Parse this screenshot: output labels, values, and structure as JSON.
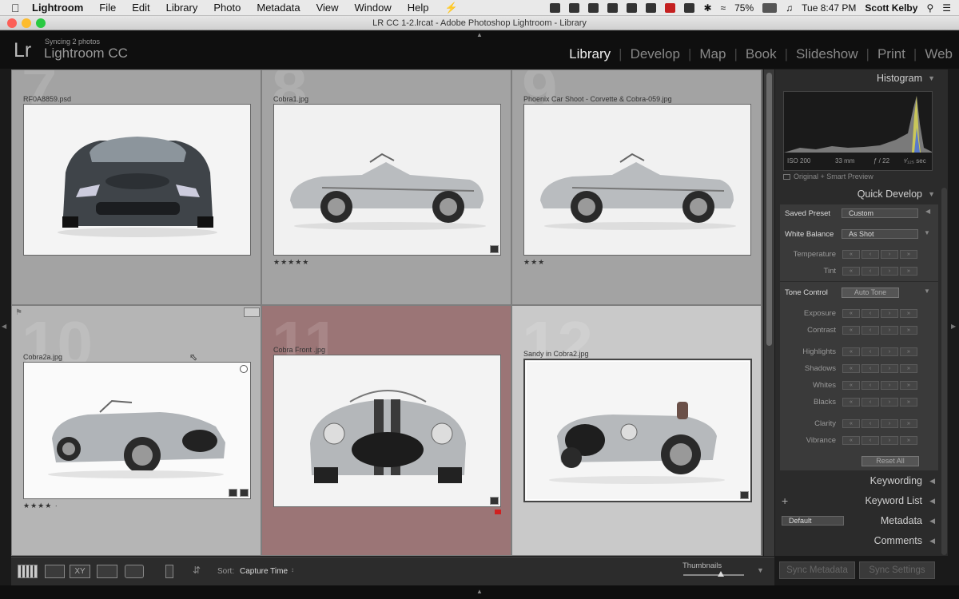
{
  "menubar": {
    "app": "Lightroom",
    "items": [
      "File",
      "Edit",
      "Library",
      "Photo",
      "Metadata",
      "View",
      "Window",
      "Help"
    ],
    "battery": "75%",
    "clock": "Tue 8:47 PM",
    "user": "Scott Kelby"
  },
  "window": {
    "title": "LR CC 1-2.lrcat - Adobe Photoshop Lightroom - Library"
  },
  "identity": {
    "logo": "Lr",
    "sync_status": "Syncing 2 photos",
    "app_name": "Lightroom CC"
  },
  "modules": [
    "Library",
    "Develop",
    "Map",
    "Book",
    "Slideshow",
    "Print",
    "Web"
  ],
  "active_module": "Library",
  "grid": {
    "cells": [
      {
        "number": "7",
        "filename": "RF0A8859.psd",
        "stars": ""
      },
      {
        "number": "8",
        "filename": "Cobra1.jpg",
        "stars": "★★★★★"
      },
      {
        "number": "9",
        "filename": "Phoenix Car Shoot - Corvette & Cobra-059.jpg",
        "stars": "★★★"
      },
      {
        "number": "10",
        "filename": "Cobra2a.jpg",
        "stars": "★★★★ ·"
      },
      {
        "number": "11",
        "filename": "Cobra Front .jpg",
        "stars": ""
      },
      {
        "number": "12",
        "filename": "Sandy in Cobra2.jpg",
        "stars": ""
      }
    ]
  },
  "panel": {
    "histogram": {
      "header": "Histogram",
      "iso": "ISO 200",
      "focal": "33 mm",
      "aperture": "ƒ / 22",
      "shutter": "¹⁄₁₂₅ sec",
      "preview_note": "Original + Smart Preview"
    },
    "quick_develop": {
      "header": "Quick Develop",
      "saved_preset_label": "Saved Preset",
      "saved_preset_value": "Custom",
      "white_balance_label": "White Balance",
      "white_balance_value": "As Shot",
      "temperature": "Temperature",
      "tint": "Tint",
      "tone_control_label": "Tone Control",
      "auto_tone": "Auto Tone",
      "exposure": "Exposure",
      "contrast": "Contrast",
      "highlights": "Highlights",
      "shadows": "Shadows",
      "whites": "Whites",
      "blacks": "Blacks",
      "clarity": "Clarity",
      "vibrance": "Vibrance",
      "reset_all": "Reset All"
    },
    "keywording": "Keywording",
    "keyword_list": "Keyword List",
    "metadata_preset": "Default",
    "metadata": "Metadata",
    "comments": "Comments",
    "sync_metadata": "Sync Metadata",
    "sync_settings": "Sync Settings"
  },
  "toolbar": {
    "sort_label": "Sort:",
    "sort_value": "Capture Time",
    "thumbnails_label": "Thumbnails"
  }
}
